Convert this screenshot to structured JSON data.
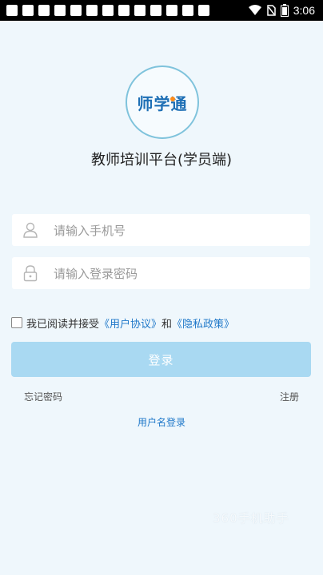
{
  "status_bar": {
    "time": "3:06"
  },
  "logo": {
    "text": "师学通"
  },
  "app_title": "教师培训平台(学员端)",
  "phone_field": {
    "placeholder": "请输入手机号",
    "icon": "user-icon"
  },
  "password_field": {
    "placeholder": "请输入登录密码",
    "icon": "lock-icon"
  },
  "agreement": {
    "prefix": "我已阅读并接受",
    "user_agreement": "《用户协议》",
    "and": "和",
    "privacy_policy": "《隐私政策》"
  },
  "login_button": "登录",
  "forgot_password": "忘记密码",
  "register": "注册",
  "username_login": "用户名登录",
  "watermark": "360手机助手",
  "colors": {
    "background": "#eff7fc",
    "button": "#a9d9f2",
    "link": "#1f78c9",
    "logo_ring": "#7fc3dc"
  }
}
